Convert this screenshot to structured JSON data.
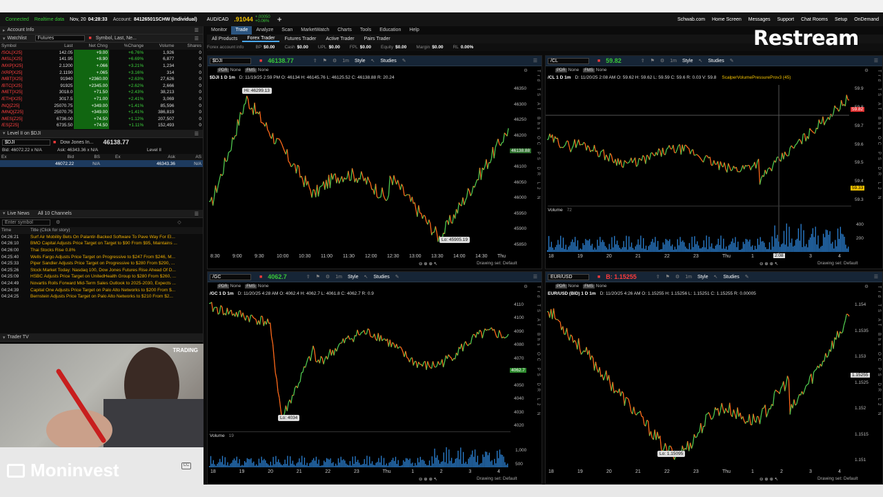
{
  "status": {
    "connected": "Connected",
    "realtime": "Realtime data",
    "datetime": "Nov, 20",
    "clock": "04:28:33",
    "account_label": "Account:",
    "account": "84126501SCHW (Individual)",
    "pair": "AUD/CAD",
    "pair_price": ".91044",
    "pair_change": "+.00050",
    "pair_pct": "+0.06%",
    "links": [
      "Schwab.com",
      "Home Screen",
      "Messages",
      "Support",
      "Chat Rooms",
      "Setup"
    ],
    "ondemand": "OnDemand"
  },
  "watermark": "Restream",
  "brand": "Moninvest",
  "left": {
    "account_info": "Account Info",
    "watchlist_label": "Watchlist",
    "watchlist_name": "Futures",
    "symbol_search": "Symbol, Last, Ne...",
    "columns": [
      "Symbol",
      "Last",
      "Net Chng",
      "%Change",
      "Volume",
      "Shares"
    ],
    "rows": [
      [
        "/SOL[X25]",
        "142.05",
        "+9.00",
        "+6.76%",
        "1,926",
        "0"
      ],
      [
        "/MSL[X25]",
        "141.95",
        "+8.90",
        "+6.69%",
        "6,877",
        "0"
      ],
      [
        "/MXP[X25]",
        "2.1200",
        "+.066",
        "+3.21%",
        "1,234",
        "0"
      ],
      [
        "/XRP[X25]",
        "2.1190",
        "+.065",
        "+3.16%",
        "314",
        "0"
      ],
      [
        "/MBT[X25]",
        "91940",
        "+2360.00",
        "+2.63%",
        "27,626",
        "0"
      ],
      [
        "/BTC[X25]",
        "91925",
        "+2345.00",
        "+2.62%",
        "2,666",
        "0"
      ],
      [
        "/MET[X25]",
        "3018.0",
        "+71.50",
        "+2.43%",
        "38,213",
        "0"
      ],
      [
        "/ETH[X25]",
        "3017.5",
        "+71.00",
        "+2.41%",
        "3,069",
        "0"
      ],
      [
        "/NQ[Z25]",
        "25070.75",
        "+349.00",
        "+1.41%",
        "85,596",
        "0"
      ],
      [
        "/MNQ[Z25]",
        "25070.75",
        "+349.00",
        "+1.41%",
        "386,819",
        "0"
      ],
      [
        "/MES[Z25]",
        "6736.00",
        "+74.50",
        "+1.12%",
        "207,507",
        "0"
      ],
      [
        "/ES[Z25]",
        "6735.50",
        "+74.50",
        "+1.11%",
        "152,493",
        "0"
      ]
    ],
    "level2_title": "Level II on $DJI",
    "level2_symbol": "$DJI",
    "level2_name": "Dow Jones In...",
    "level2_price": "46138.77",
    "level2_bid": "Bid: 46072.22 x N/A",
    "level2_ask": "Ask: 46343.36 x N/A",
    "level2_label": "Level II",
    "level2_cols": [
      "Ex",
      "Bid",
      "BS",
      "Ex",
      "Ask",
      "AS"
    ],
    "level2_row": [
      "46072.22",
      "N/A",
      "46343.36",
      "N/A"
    ],
    "news_tab1": "Live News",
    "news_tab2": "All 10 Channels",
    "news_search": "Enter symbol",
    "news_cols": [
      "Time",
      "Title (Click for story)"
    ],
    "news": [
      [
        "04:26:21",
        "Surf Air Mobility Bets On Palantir-Backed Software To Pave Way For El..."
      ],
      [
        "04:26:10",
        "BMO Capital Adjusts Price Target on Target to $90 From $95, Maintains ..."
      ],
      [
        "04:26:00",
        "Thai Stocks Rise 0.8%"
      ],
      [
        "04:25:40",
        "Wells Fargo Adjusts Price Target on Progressive to $247 From $246, M..."
      ],
      [
        "04:25:33",
        "Piper Sandler Adjusts Price Target on Progressive to $280 From $290, ..."
      ],
      [
        "04:25:26",
        "Stock Market Today: Nasdaq 100, Dow Jones Futures Rise Ahead Of D..."
      ],
      [
        "04:25:09",
        "HSBC Adjusts Price Target on UnitedHealth Group to $280 From $260, ..."
      ],
      [
        "04:24:49",
        "Novartis Rolls Forward Mid-Term Sales Outlook to 2025-2030, Expects ..."
      ],
      [
        "04:24:39",
        "Capital One Adjusts Price Target on Palo Alto Networks to $200 From $..."
      ],
      [
        "04:24:25",
        "Bernstein Adjusts Price Target on Palo Alto Networks to $210 From $2..."
      ]
    ],
    "trader_tv": "Trader TV",
    "video_badge": "TRADING"
  },
  "main": {
    "tabs": [
      "Monitor",
      "Trade",
      "Analyze",
      "Scan",
      "MarketWatch",
      "Charts",
      "Tools",
      "Education",
      "Help"
    ],
    "active_tab": "Trade",
    "subtabs": [
      "All Products",
      "Forex Trader",
      "Futures Trader",
      "Active Trader",
      "Pairs Trader"
    ],
    "account_fields": [
      [
        "Forex account info",
        ""
      ],
      [
        "BP",
        "$0.00"
      ],
      [
        "Cash",
        "$0.00"
      ],
      [
        "UPL",
        "$0.00"
      ],
      [
        "FPL",
        "$0.00"
      ],
      [
        "Equity",
        "$0.00"
      ],
      [
        "Margin",
        "$0.00"
      ],
      [
        "RL",
        "0.00%"
      ]
    ]
  },
  "charts": [
    {
      "id": "dji",
      "symbol": "$DJI",
      "price": "46138.77",
      "title": "$DJI 1 D 1m",
      "ohlc": "D: 11/19/25 2:59 PM  O: 46134  H: 46145.76  L: 46125.52  C: 46138.88  R: 20.24",
      "hi_label": "Hi: 46299.13",
      "lo_label": "Lo: 45905.19",
      "yticks": [
        "46350",
        "46300",
        "46250",
        "46200",
        "46150",
        "46100",
        "46050",
        "46000",
        "45950",
        "45900",
        "45850"
      ],
      "xticks": [
        "8:30",
        "9:00",
        "9:30",
        "10:00",
        "10:30",
        "11:00",
        "11:30",
        "12:00",
        "12:30",
        "13:00",
        "13:30",
        "14:00",
        "14:30",
        "Thu"
      ],
      "last_tag": "46138.88",
      "drawing_set": "Drawing set: Default"
    },
    {
      "id": "cl",
      "symbol": "/CL",
      "price": "59.82",
      "title": "/CL 1 D 1m",
      "ohlc": "D: 11/20/25 2:08 AM  O: 59.62  H: 59.62  L: 59.59  C: 59.6  R: 0.03  V: 59.8",
      "study": "ScalperVolumePressureProv3 (45)",
      "yticks": [
        "59.9",
        "59.8",
        "59.7",
        "59.6",
        "59.5",
        "59.4",
        "59.3"
      ],
      "xticks": [
        "18",
        "19",
        "20",
        "21",
        "22",
        "23",
        "Thu",
        "1",
        "2",
        "3",
        "4"
      ],
      "volume_label": "Volume",
      "volume_value": "72",
      "vol_ticks": [
        "400",
        "200"
      ],
      "time_tag": "2:08",
      "last_tag": "59.82",
      "low_tag": "59.33",
      "drawing_set": "Drawing set: Default"
    },
    {
      "id": "gc",
      "symbol": "/GC",
      "price": "4062.7",
      "title": "/GC 1 D 1m",
      "ohlc": "D: 11/20/25 4:28 AM  O: 4062.4  H: 4062.7  L: 4061.8  C: 4062.7  R: 0.9",
      "lo_label": "Lo: 4034",
      "yticks": [
        "4110",
        "4100",
        "4090",
        "4080",
        "4070",
        "4060",
        "4050",
        "4040",
        "4030",
        "4020"
      ],
      "xticks": [
        "18",
        "19",
        "20",
        "21",
        "22",
        "23",
        "Thu",
        "1",
        "2",
        "3",
        "4"
      ],
      "volume_label": "Volume",
      "volume_value": "19",
      "vol_ticks": [
        "1,000",
        "500"
      ],
      "last_tag": "4062.7",
      "drawing_set": "Drawing set: Default"
    },
    {
      "id": "eur",
      "symbol": "EUR/USD",
      "price": "B: 1.15255",
      "title": "EUR/USD (BID) 1 D 1m",
      "ohlc": "D: 11/20/25 4:26 AM  O: 1.15255  H: 1.15256  L: 1.15251  C: 1.15255  R: 0.00005",
      "lo_label": "Lo: 1.15095",
      "yticks": [
        "1.154",
        "1.1535",
        "1.153",
        "1.1525",
        "1.152",
        "1.1515",
        "1.151"
      ],
      "xticks": [
        "18",
        "19",
        "20",
        "21",
        "22",
        "23",
        "Thu",
        "1",
        "2",
        "3",
        "4"
      ],
      "last_tag": "1.15255",
      "drawing_set": "Drawing set: Default"
    }
  ],
  "chart_toolbar": [
    "Style",
    "Studies"
  ],
  "chart_flags": [
    "None",
    "None"
  ]
}
